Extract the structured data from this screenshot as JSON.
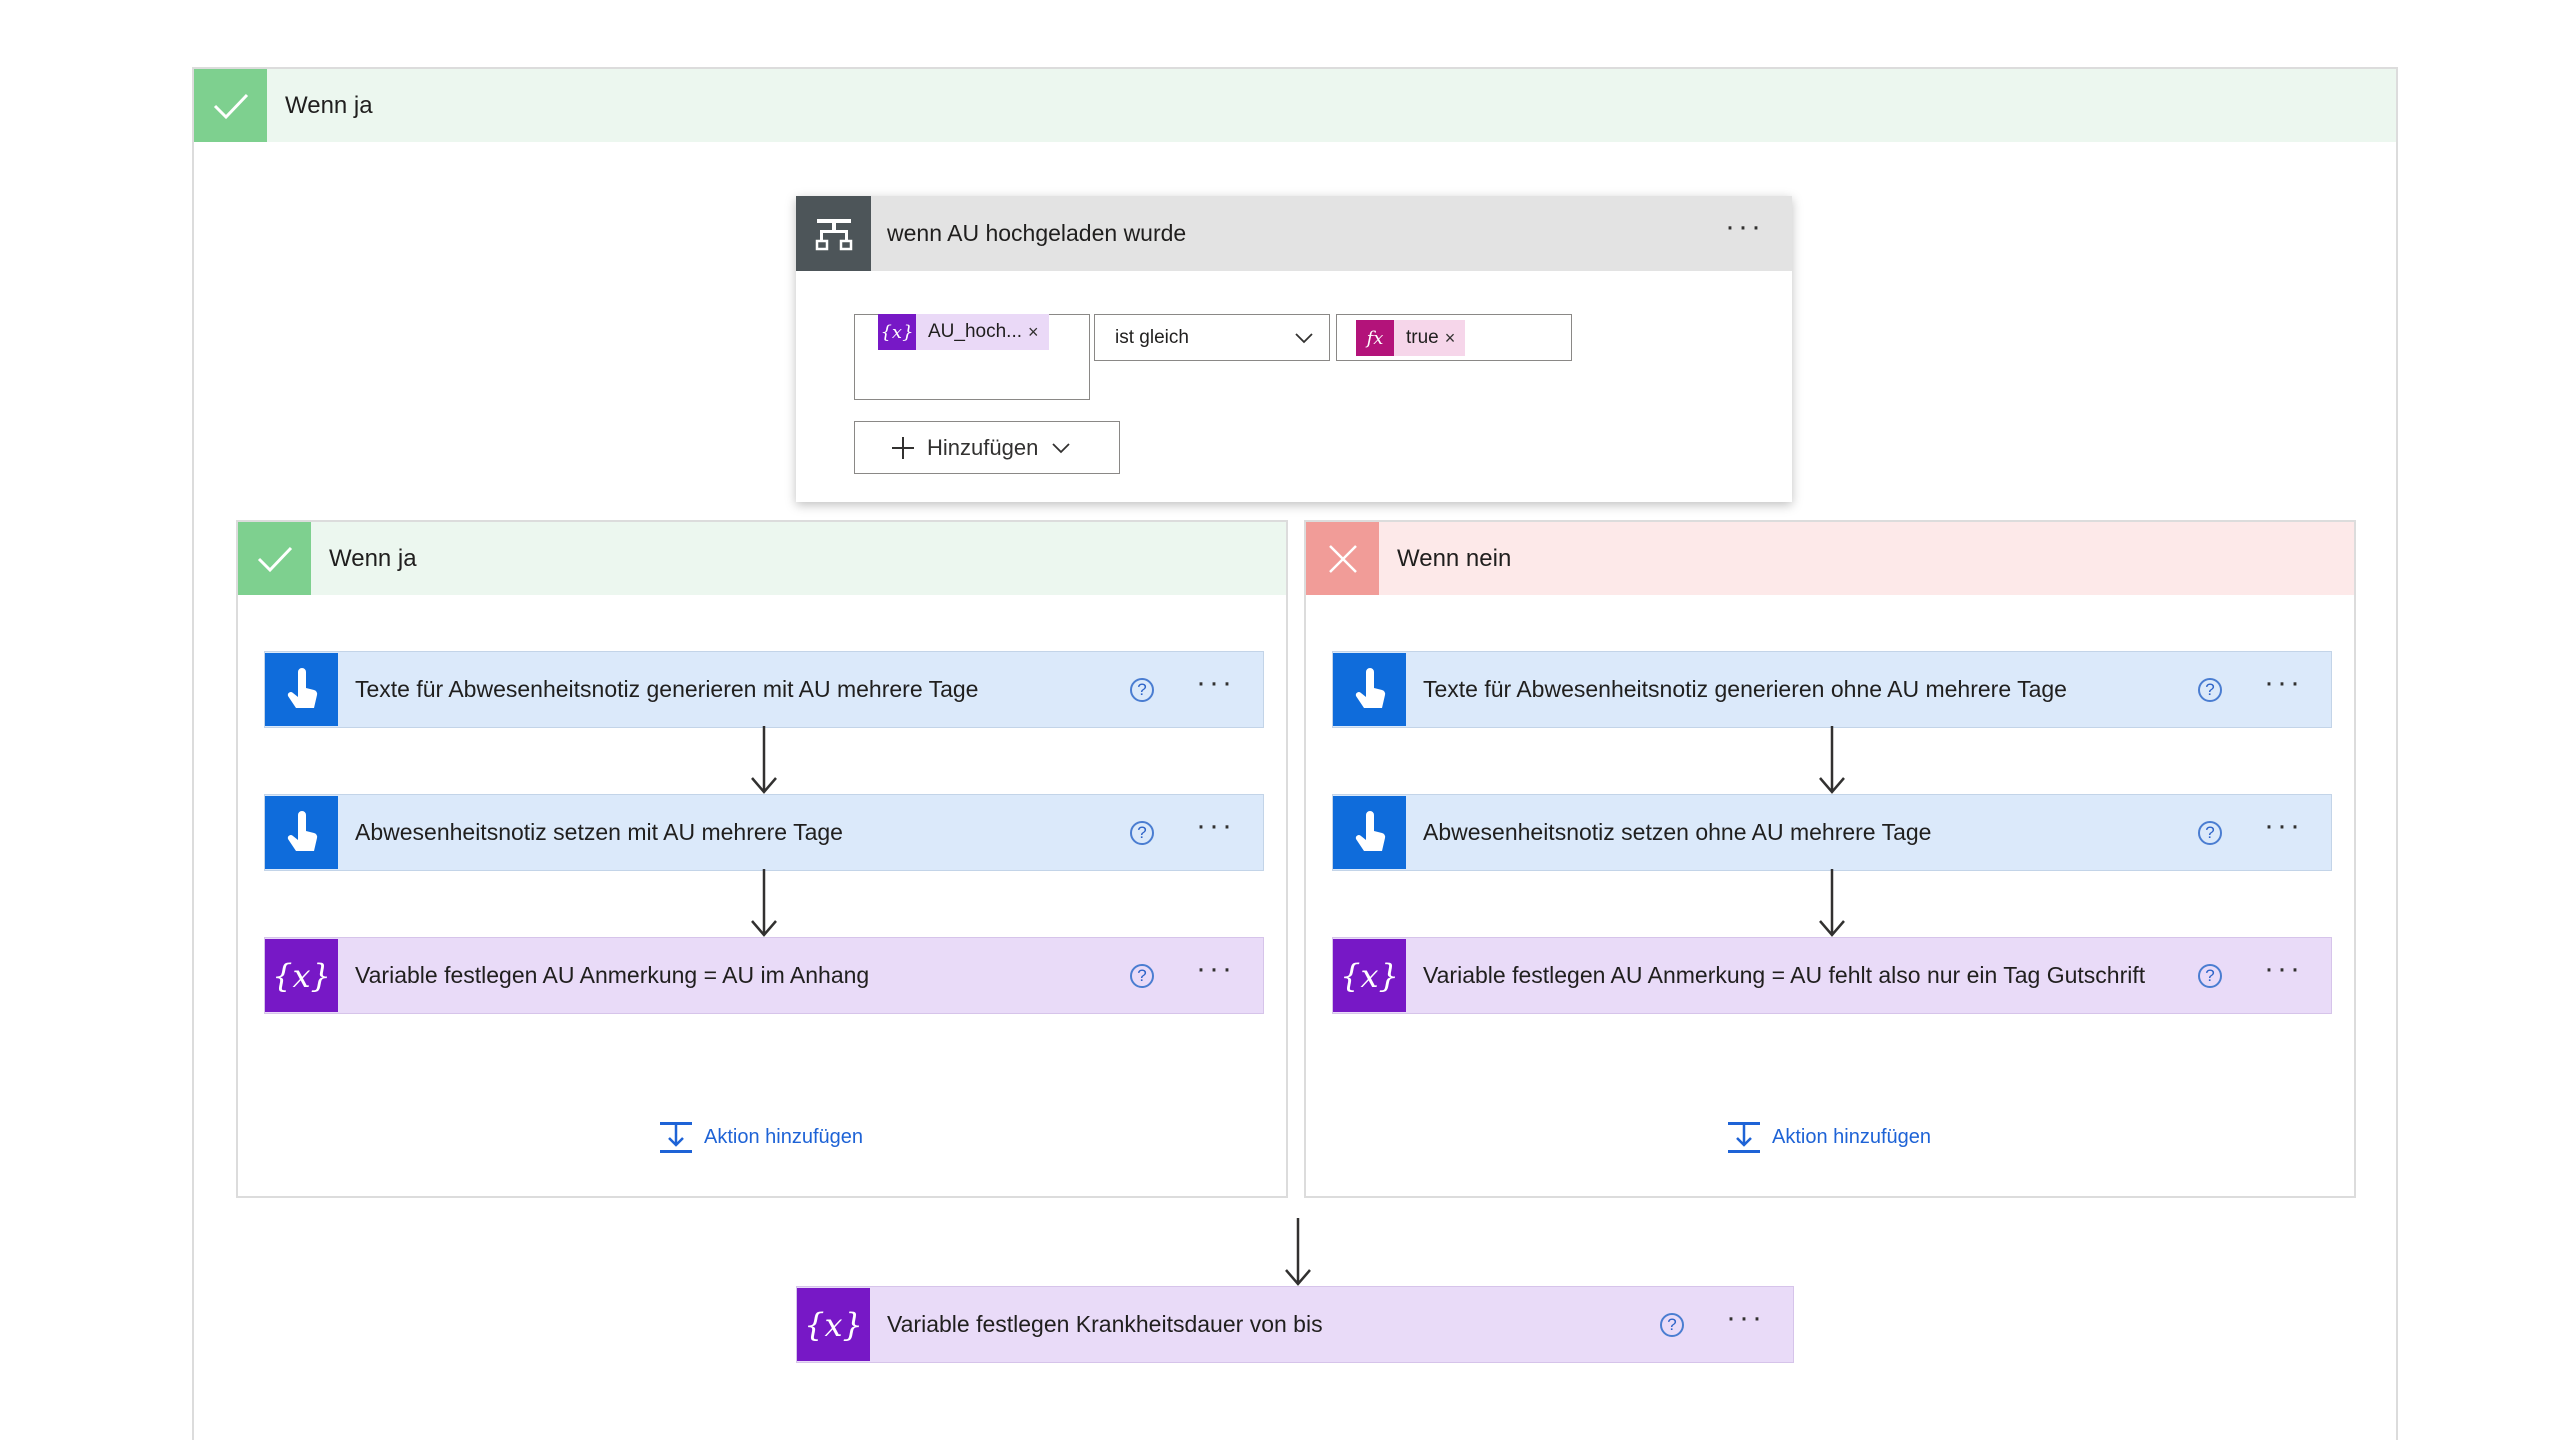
{
  "colors": {
    "condition_header": "#4d5559",
    "manual_action": "#0f6cdb",
    "variable_action": "#7718c6",
    "yes_branch": "#7ed08f",
    "no_branch": "#f19c98",
    "link": "#1e63d6"
  },
  "outer_branch": {
    "label": "Wenn ja",
    "icon": "checkmark-icon"
  },
  "condition": {
    "title": "wenn AU hochgeladen wurde",
    "icon": "condition-icon",
    "left_token": {
      "label": "AU_hoch...",
      "icon": "variable-icon",
      "remove": "×"
    },
    "operator": "ist gleich",
    "right_token": {
      "label": "true",
      "icon": "function-icon",
      "remove": "×"
    },
    "add_button": "Hinzufügen",
    "more": "···"
  },
  "yes_branch": {
    "label": "Wenn ja",
    "actions": [
      {
        "label": "Texte für Abwesenheitsnotiz generieren mit AU mehrere Tage",
        "icon": "touch-icon"
      },
      {
        "label": "Abwesenheitsnotiz setzen mit AU mehrere Tage",
        "icon": "touch-icon"
      },
      {
        "label": "Variable festlegen AU Anmerkung = AU im Anhang",
        "icon": "variable-icon"
      }
    ],
    "add_action": "Aktion hinzufügen"
  },
  "no_branch": {
    "label": "Wenn nein",
    "actions": [
      {
        "label": "Texte für Abwesenheitsnotiz generieren ohne AU mehrere Tage",
        "icon": "touch-icon"
      },
      {
        "label": "Abwesenheitsnotiz setzen ohne AU mehrere Tage",
        "icon": "touch-icon"
      },
      {
        "label": "Variable festlegen AU Anmerkung = AU fehlt also nur ein Tag Gutschrift",
        "icon": "variable-icon"
      }
    ],
    "add_action": "Aktion hinzufügen"
  },
  "final_action": {
    "label": "Variable festlegen Krankheitsdauer von bis",
    "icon": "variable-icon"
  },
  "glyphs": {
    "help": "?",
    "more": "···",
    "variable": "{x}",
    "function": "fx"
  }
}
